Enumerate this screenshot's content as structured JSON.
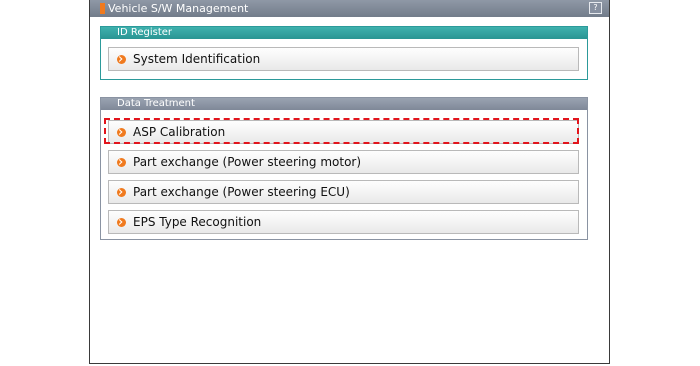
{
  "window": {
    "title": "Vehicle S/W Management",
    "help_icon": "help-icon"
  },
  "id_register": {
    "header": "ID Register",
    "items": [
      {
        "label": "System Identification"
      }
    ]
  },
  "data_treatment": {
    "header": "Data Treatment",
    "items": [
      {
        "label": "ASP Calibration",
        "highlighted": true
      },
      {
        "label": "Part exchange (Power steering motor)"
      },
      {
        "label": "Part exchange (Power steering ECU)"
      },
      {
        "label": "EPS Type Recognition"
      }
    ]
  },
  "colors": {
    "accent_orange": "#f07a1e",
    "id_register_teal": "#2c9a9a",
    "titlebar_gray": "#7f8898",
    "highlight_red": "#e2141c"
  }
}
